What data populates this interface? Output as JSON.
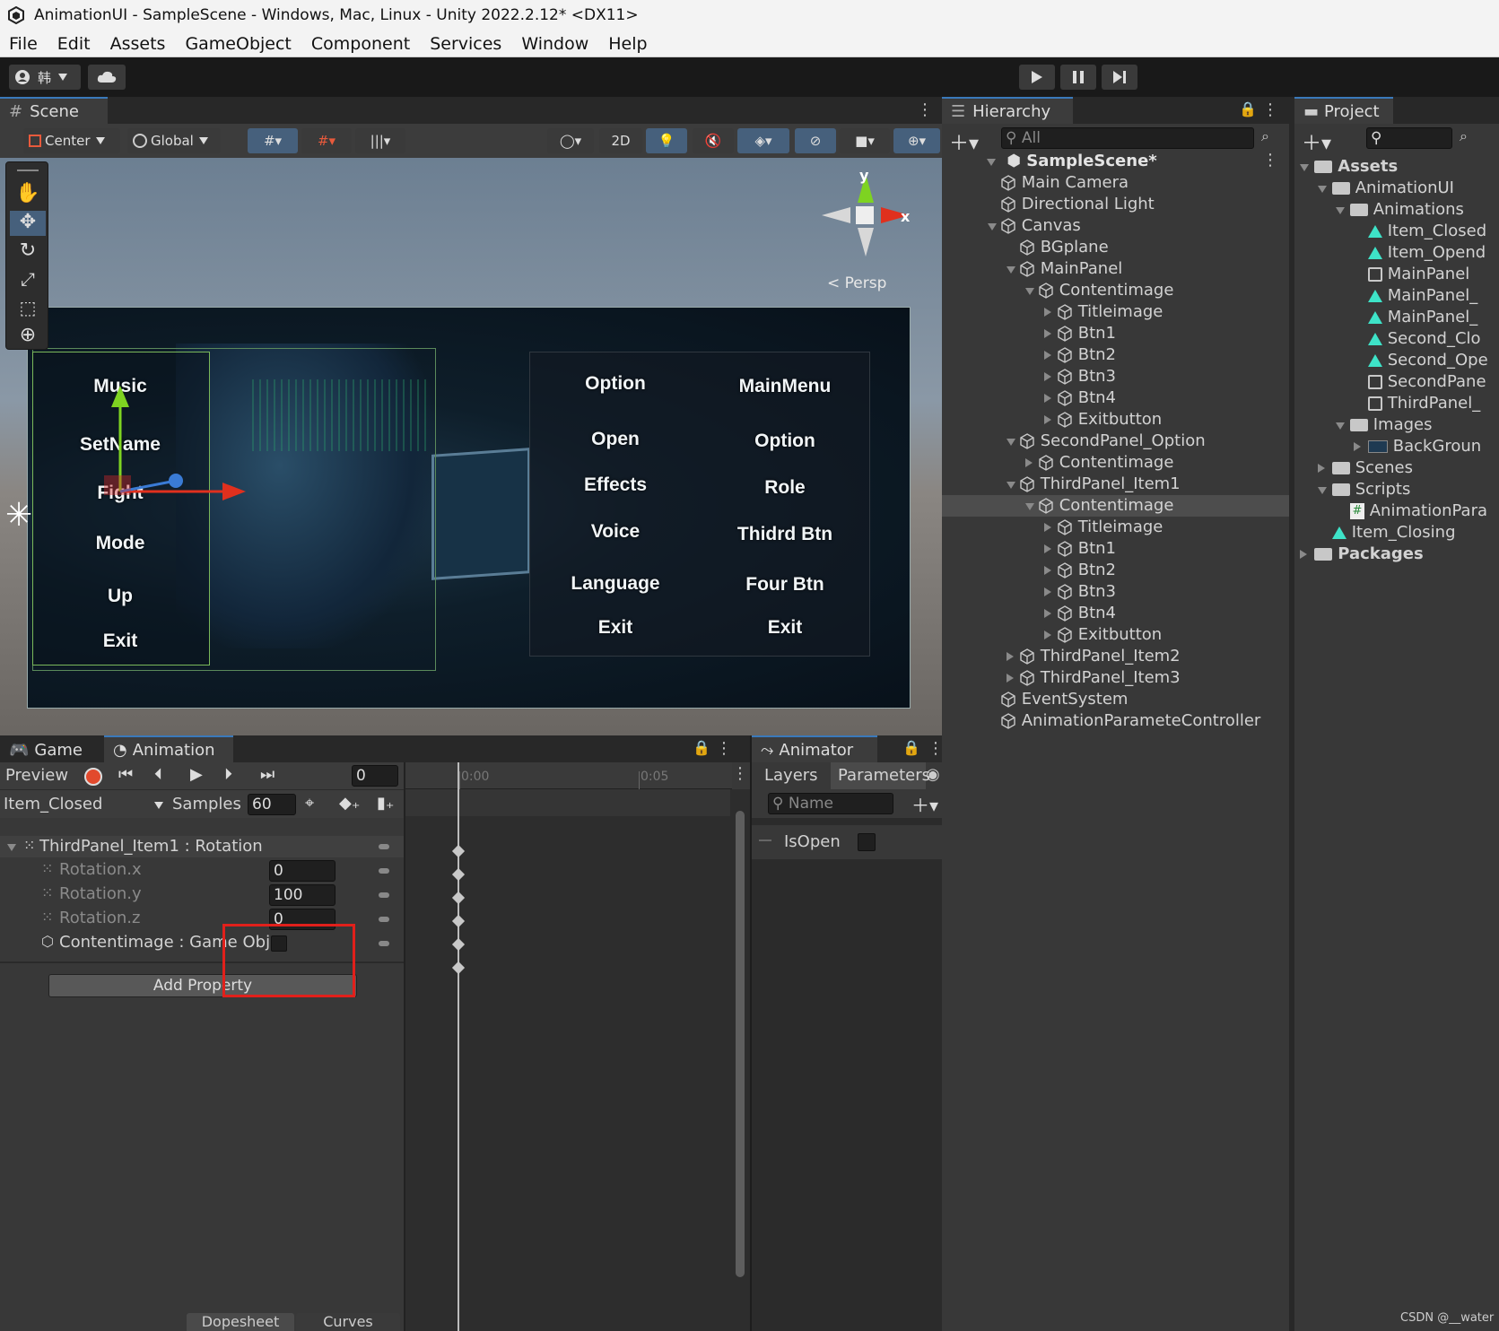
{
  "window": {
    "title": "AnimationUI - SampleScene - Windows, Mac, Linux - Unity 2022.2.12* <DX11>"
  },
  "menu": [
    "File",
    "Edit",
    "Assets",
    "GameObject",
    "Component",
    "Services",
    "Window",
    "Help"
  ],
  "toolbar": {
    "account_label": "韩"
  },
  "scene": {
    "tab": "Scene",
    "pivot": "Center",
    "space": "Global",
    "mode_2d": "2D",
    "persp": "< Persp",
    "gizmo_y": "y",
    "gizmo_x": "x",
    "left_menu": [
      "Music",
      "SetName",
      "Fight",
      "Mode",
      "Up",
      "Exit"
    ],
    "mid_menu": [
      "Option",
      "Open",
      "Effects",
      "Voice",
      "Language",
      "Exit"
    ],
    "right_menu": [
      "MainMenu",
      "Option",
      "Role",
      "Thidrd Btn",
      "Four Btn",
      "Exit"
    ]
  },
  "hierarchy": {
    "tab": "Hierarchy",
    "search_placeholder": "All",
    "scene": "SampleScene*",
    "items": [
      {
        "label": "Main Camera",
        "depth": 1,
        "arrow": "none"
      },
      {
        "label": "Directional Light",
        "depth": 1,
        "arrow": "none"
      },
      {
        "label": "Canvas",
        "depth": 1,
        "arrow": "down"
      },
      {
        "label": "BGplane",
        "depth": 2,
        "arrow": "none"
      },
      {
        "label": "MainPanel",
        "depth": 2,
        "arrow": "down"
      },
      {
        "label": "Contentimage",
        "depth": 3,
        "arrow": "down"
      },
      {
        "label": "Titleimage",
        "depth": 4,
        "arrow": "right"
      },
      {
        "label": "Btn1",
        "depth": 4,
        "arrow": "right"
      },
      {
        "label": "Btn2",
        "depth": 4,
        "arrow": "right"
      },
      {
        "label": "Btn3",
        "depth": 4,
        "arrow": "right"
      },
      {
        "label": "Btn4",
        "depth": 4,
        "arrow": "right"
      },
      {
        "label": "Exitbutton",
        "depth": 4,
        "arrow": "right"
      },
      {
        "label": "SecondPanel_Option",
        "depth": 2,
        "arrow": "down"
      },
      {
        "label": "Contentimage",
        "depth": 3,
        "arrow": "right"
      },
      {
        "label": "ThirdPanel_Item1",
        "depth": 2,
        "arrow": "down"
      },
      {
        "label": "Contentimage",
        "depth": 3,
        "arrow": "down",
        "selected": true
      },
      {
        "label": "Titleimage",
        "depth": 4,
        "arrow": "right"
      },
      {
        "label": "Btn1",
        "depth": 4,
        "arrow": "right"
      },
      {
        "label": "Btn2",
        "depth": 4,
        "arrow": "right"
      },
      {
        "label": "Btn3",
        "depth": 4,
        "arrow": "right"
      },
      {
        "label": "Btn4",
        "depth": 4,
        "arrow": "right"
      },
      {
        "label": "Exitbutton",
        "depth": 4,
        "arrow": "right"
      },
      {
        "label": "ThirdPanel_Item2",
        "depth": 2,
        "arrow": "right"
      },
      {
        "label": "ThirdPanel_Item3",
        "depth": 2,
        "arrow": "right"
      },
      {
        "label": "EventSystem",
        "depth": 1,
        "arrow": "none"
      },
      {
        "label": "AnimationParameteController",
        "depth": 1,
        "arrow": "none"
      }
    ]
  },
  "project": {
    "tab": "Project",
    "items": [
      {
        "label": "Assets",
        "depth": 0,
        "arrow": "down",
        "icon": "folder-open",
        "bold": true
      },
      {
        "label": "AnimationUI",
        "depth": 1,
        "arrow": "down",
        "icon": "folder-open"
      },
      {
        "label": "Animations",
        "depth": 2,
        "arrow": "down",
        "icon": "folder-open"
      },
      {
        "label": "Item_Closed",
        "depth": 3,
        "arrow": "none",
        "icon": "anim"
      },
      {
        "label": "Item_Opend",
        "depth": 3,
        "arrow": "none",
        "icon": "anim"
      },
      {
        "label": "MainPanel",
        "depth": 3,
        "arrow": "none",
        "icon": "controller"
      },
      {
        "label": "MainPanel_",
        "depth": 3,
        "arrow": "none",
        "icon": "anim"
      },
      {
        "label": "MainPanel_",
        "depth": 3,
        "arrow": "none",
        "icon": "anim"
      },
      {
        "label": "Second_Clo",
        "depth": 3,
        "arrow": "none",
        "icon": "anim"
      },
      {
        "label": "Second_Ope",
        "depth": 3,
        "arrow": "none",
        "icon": "anim"
      },
      {
        "label": "SecondPane",
        "depth": 3,
        "arrow": "none",
        "icon": "controller"
      },
      {
        "label": "ThirdPanel_",
        "depth": 3,
        "arrow": "none",
        "icon": "controller"
      },
      {
        "label": "Images",
        "depth": 2,
        "arrow": "down",
        "icon": "folder-open"
      },
      {
        "label": "BackGroun",
        "depth": 3,
        "arrow": "right",
        "icon": "image"
      },
      {
        "label": "Scenes",
        "depth": 1,
        "arrow": "right",
        "icon": "folder"
      },
      {
        "label": "Scripts",
        "depth": 1,
        "arrow": "down",
        "icon": "folder-open"
      },
      {
        "label": "AnimationPara",
        "depth": 2,
        "arrow": "none",
        "icon": "script"
      },
      {
        "label": "Item_Closing",
        "depth": 1,
        "arrow": "none",
        "icon": "anim"
      },
      {
        "label": "Packages",
        "depth": 0,
        "arrow": "right",
        "icon": "folder",
        "bold": true
      }
    ]
  },
  "animation": {
    "tab_game": "Game",
    "tab_animation": "Animation",
    "preview": "Preview",
    "frame": "0",
    "clip": "Item_Closed",
    "samples_label": "Samples",
    "samples": "60",
    "time_0": "0:00",
    "time_1": "0:05",
    "property_group": "ThirdPanel_Item1 : Rotation",
    "properties": [
      {
        "name": "Rotation.x",
        "value": "0"
      },
      {
        "name": "Rotation.y",
        "value": "100"
      },
      {
        "name": "Rotation.z",
        "value": "0"
      }
    ],
    "gameobject_prop": "Contentimage : Game Obje",
    "add_property": "Add Property",
    "dopesheet": "Dopesheet",
    "curves": "Curves"
  },
  "animator": {
    "tab": "Animator",
    "layers": "Layers",
    "parameters": "Parameters",
    "name_placeholder": "Name",
    "param": "IsOpen"
  },
  "watermark": "CSDN @__water",
  "colors": {
    "accent": "#3a79bb",
    "highlight_box": "#e1201b",
    "selection": "#4d4d4d"
  }
}
